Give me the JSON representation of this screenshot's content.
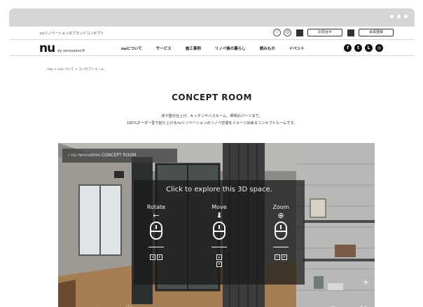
{
  "site": {
    "tagline": "nuリノベーションのブランドコンセプト",
    "logo_mark": "nu",
    "logo_sub": "by renovation®",
    "top_buttons": [
      "お問合せ",
      "会員登録"
    ],
    "nav": [
      "nuについて",
      "サービス",
      "施工事例",
      "リノベ後の暮らし",
      "読みもの",
      "イベント"
    ],
    "social_icons": [
      "facebook-icon",
      "twitter-icon",
      "line-icon",
      "instagram-icon"
    ]
  },
  "breadcrumb": "top  >  nuについて  >  コンセプトルーム",
  "hero": {
    "title": "CONCEPT ROOM",
    "desc_line1": "床や壁の仕上げ、キッチンやバスルーム、照明のパーツまで。",
    "desc_line2": "100%オーダー型で創り上げるnuリノベーションのリノベ空間をイメージ出来るコンセプトルームです。"
  },
  "viewer": {
    "label": "‹  nu renovation CONCEPT ROOM",
    "prompt": "Click to explore this 3D space.",
    "controls": [
      {
        "label": "Rotate",
        "glyph": "←",
        "keys": [
          "◂",
          "▸"
        ]
      },
      {
        "label": "Move",
        "glyph": "⬇",
        "keys": [
          "▴",
          "▾"
        ]
      },
      {
        "label": "Zoom",
        "glyph": "⊕",
        "keys": [
          "−",
          "+"
        ]
      }
    ],
    "bottom_icons": [
      "chevron-up-icon",
      "prev-icon",
      "play-icon",
      "next-icon",
      "info-icon",
      "vr-icon",
      "share-icon",
      "fullscreen-icon"
    ]
  },
  "colors": {
    "chrome": "#d6d6d6",
    "accent": "#111111"
  }
}
